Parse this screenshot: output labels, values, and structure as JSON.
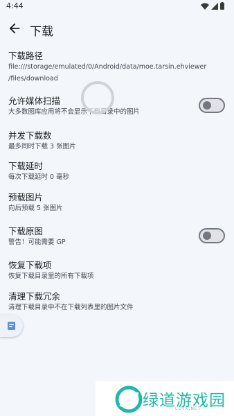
{
  "status_bar": {
    "time": "4:44"
  },
  "app_bar": {
    "title": "下载"
  },
  "settings": [
    {
      "title": "下载路径",
      "summary_lines": [
        "file:///storage/emulated/0/Android/data/moe.tarsin.ehviewer",
        "/files/download"
      ]
    },
    {
      "title": "允许媒体扫描",
      "summary_lines": [
        "大多数图库应用将不会显示下载目录中的图片"
      ],
      "toggle": false
    },
    {
      "title": "并发下载数",
      "summary_lines": [
        "最多同时下载 3 张图片"
      ]
    },
    {
      "title": "下载延时",
      "summary_lines": [
        "每次下载延时 0 毫秒"
      ]
    },
    {
      "title": "预载图片",
      "summary_lines": [
        "向后预载 5 张图片"
      ]
    },
    {
      "title": "下载原图",
      "summary_lines": [
        "警告！可能需要 GP"
      ],
      "toggle": false
    },
    {
      "title": "恢复下载项",
      "summary_lines": [
        "恢复下载目录里的所有下载项"
      ]
    },
    {
      "title": "清理下载冗余",
      "summary_lines": [
        "清理下载目录中不在下载列表里的图片文件"
      ]
    }
  ],
  "watermark": {
    "brand": "绿道游戏园",
    "sub": "LDYX.NET"
  },
  "colors": {
    "background": "#f3f6fb",
    "watermark": "#20b8a7"
  }
}
